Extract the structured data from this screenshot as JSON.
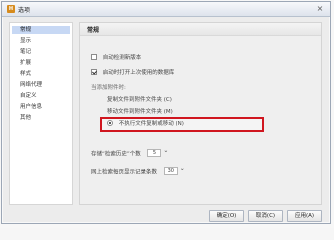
{
  "window": {
    "title": "选项",
    "icon_text": "H"
  },
  "sidebar": {
    "items": [
      {
        "label": "常规",
        "active": true
      },
      {
        "label": "显示"
      },
      {
        "label": "笔记"
      },
      {
        "label": "扩展"
      },
      {
        "label": "样式"
      },
      {
        "label": "网络代理"
      },
      {
        "label": "自定义"
      },
      {
        "label": "用户信息"
      },
      {
        "label": "其他"
      }
    ]
  },
  "section": {
    "title": "常规"
  },
  "options": {
    "auto_update": "自动检测新版本",
    "startup_load": "启动时打开上次使用的数据库",
    "when_open_file": "当添加附件时:",
    "copy_file": "复制文件到附件文件夹 (C)",
    "move_file": "移动文件到附件文件夹 (M)",
    "no_copy": "不执行文件复制或移动 (N)",
    "history_label": "存储“检索历史”个数",
    "history_value": "5",
    "online_label": "网上检索每页显示记录条数",
    "online_value": "30"
  },
  "buttons": {
    "ok": "确定(O)",
    "cancel": "取消(C)",
    "apply": "应用(A)"
  },
  "colors": {
    "highlight": "#d0161f",
    "active_sidebar": "#c7d8f4"
  }
}
